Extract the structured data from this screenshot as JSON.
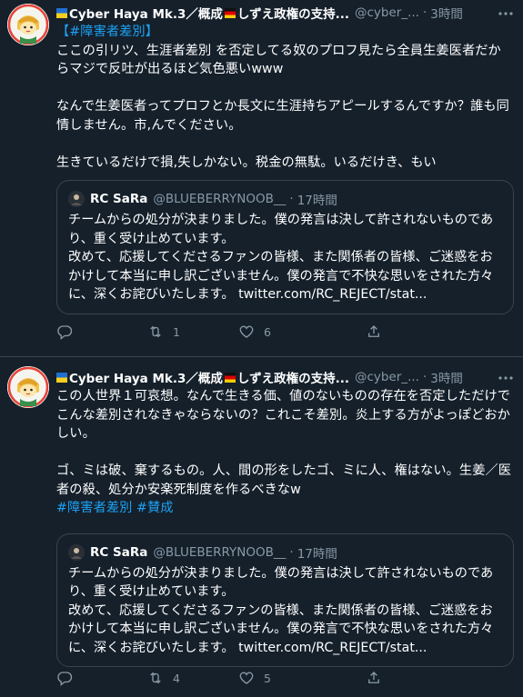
{
  "tweets": [
    {
      "author": {
        "name": "Cyber Haya Mk.3／概成",
        "name_suffix": "しずえ政権の支持...",
        "handle": "@cyber_...",
        "time": "3時間"
      },
      "dot": "·",
      "body": {
        "hashtag_line": "【#障害者差別】",
        "p1": "ここの引リツ、生涯者差別 を否定してる奴のプロフ見たら全員生姜医者だからマジで反吐が出るほど気色悪いwww",
        "p2": "なんで生姜医者ってプロフとか長文に生涯持ちアピールするんですか？誰も同情しません。市,んでください。",
        "p3": "生きているだけで損,失しかない。税金の無駄。いるだけき、もい"
      },
      "quote": {
        "name": "RC SaRa",
        "handle": "@BLUEBERRYNOOB__",
        "time": "17時間",
        "p1": "チームからの処分が決まりました。僕の発言は決して許されないものであり、重く受け止めています。",
        "p2": "改めて、応援してくださるファンの皆様、また関係者の皆様、ご迷惑をおかけして本当に申し訳ございません。僕の発言で不快な思いをされた方々に、深くお詫びいたします。",
        "link": "twitter.com/RC_REJECT/stat..."
      },
      "actions": {
        "reply": "",
        "retweet": "1",
        "like": "6"
      }
    },
    {
      "author": {
        "name": "Cyber Haya Mk.3／概成",
        "name_suffix": "しずえ政権の支持...",
        "handle": "@cyber_...",
        "time": "3時間"
      },
      "dot": "·",
      "body": {
        "p1": "この人世界１可哀想。なんで生きる価、値のないものの存在を否定しただけでこんな差別されなきゃならないの？これこそ差別。炎上する方がよっぽどおかしい。",
        "p2": "ゴ、ミは破、棄するもの。人、間の形をしたゴ、ミに人、権はない。生姜／医者の殺、処分か安楽死制度を作るべきなw",
        "hashtags": "#障害者差別 #賛成"
      },
      "quote": {
        "name": "RC SaRa",
        "handle": "@BLUEBERRYNOOB__",
        "time": "17時間",
        "p1": "チームからの処分が決まりました。僕の発言は決して許されないものであり、重く受け止めています。",
        "p2": "改めて、応援してくださるファンの皆様、また関係者の皆様、ご迷惑をおかけして本当に申し訳ございません。僕の発言で不快な思いをされた方々に、深くお詫びいたします。",
        "link": "twitter.com/RC_REJECT/stat..."
      },
      "actions": {
        "reply": "",
        "retweet": "4",
        "like": "5"
      }
    }
  ],
  "colors": {
    "background": "#15202b",
    "muted": "#8899a6",
    "accent": "#1da1f2",
    "border": "#38444d"
  },
  "icons": [
    "avatar-icon",
    "reply-icon",
    "retweet-icon",
    "like-icon",
    "share-icon",
    "more-icon",
    "flag-ukraine-icon",
    "flag-germany-icon"
  ]
}
